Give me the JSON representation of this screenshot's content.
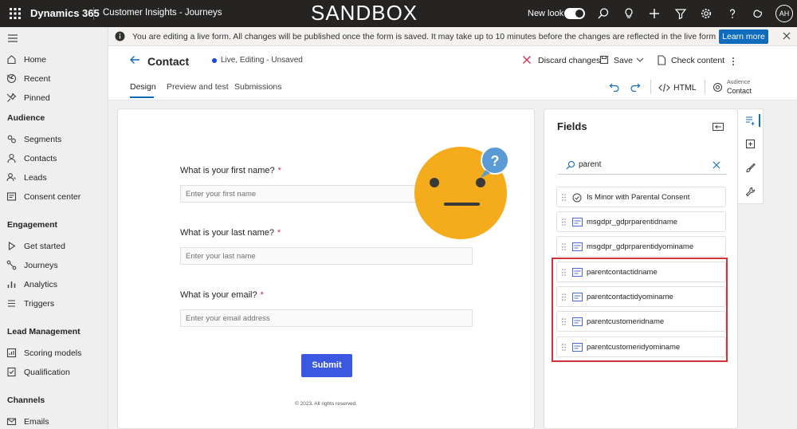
{
  "topbar": {
    "app_name": "Dynamics 365",
    "area_name": "Customer Insights - Journeys",
    "environment_label": "SANDBOX",
    "new_look_label": "New look",
    "new_look_on": true,
    "avatar_initials": "AH",
    "icons": [
      "search-icon",
      "lightbulb-icon",
      "plus-icon",
      "filter-icon",
      "gear-icon",
      "help-icon",
      "copilot-icon"
    ]
  },
  "nav": {
    "items": [
      {
        "label": "Home",
        "icon": "home-icon"
      },
      {
        "label": "Recent",
        "icon": "clock-icon",
        "expandable": true
      },
      {
        "label": "Pinned",
        "icon": "pin-icon",
        "expandable": true
      }
    ],
    "groups": [
      {
        "title": "Audience",
        "items": [
          "Segments",
          "Contacts",
          "Leads",
          "Consent center"
        ]
      },
      {
        "title": "Engagement",
        "items": [
          "Get started",
          "Journeys",
          "Analytics",
          "Triggers"
        ]
      },
      {
        "title": "Lead Management",
        "items": [
          "Scoring models",
          "Qualification"
        ]
      },
      {
        "title": "Channels",
        "items": [
          "Emails"
        ]
      }
    ]
  },
  "banner": {
    "text": "You are editing a live form. All changes will be published once the form is saved. It may take up to 10 minutes before the changes are reflected in the live form",
    "button_label": "Learn more"
  },
  "header": {
    "title": "Contact",
    "status": "Live, Editing - Unsaved",
    "discard_label": "Discard changes",
    "save_label": "Save",
    "check_label": "Check content",
    "tabs": [
      "Design",
      "Preview and test",
      "Submissions"
    ],
    "active_tab": "Design",
    "html_label": "HTML",
    "audience_label": "Audience",
    "audience_value": "Contact"
  },
  "form": {
    "questions": [
      {
        "label": "What is your first name?",
        "placeholder": "Enter your first name"
      },
      {
        "label": "What is your last name?",
        "placeholder": "Enter your last name"
      },
      {
        "label": "What is your email?",
        "placeholder": "Enter your email address"
      }
    ],
    "required_mark": "*",
    "submit_label": "Submit",
    "footer": "© 2023. All rights reserved.",
    "emoji_badge": "?"
  },
  "fields_panel": {
    "title": "Fields",
    "search_value": "parent",
    "items": [
      {
        "label": "Is Minor with Parental Consent",
        "icon": "check-circle-icon"
      },
      {
        "label": "msgdpr_gdprparentidname",
        "icon": "text-field-icon"
      },
      {
        "label": "msgdpr_gdprparentidyominame",
        "icon": "text-field-icon"
      },
      {
        "label": "parentcontactidname",
        "icon": "text-field-icon"
      },
      {
        "label": "parentcontactidyominame",
        "icon": "text-field-icon"
      },
      {
        "label": "parentcustomeridname",
        "icon": "text-field-icon"
      },
      {
        "label": "parentcustomeridyominame",
        "icon": "text-field-icon"
      }
    ]
  },
  "colors": {
    "topbar_bg": "#252423",
    "accent": "#0f6cbd",
    "submit_bg": "#3b58e0",
    "highlight": "#d13438",
    "emoji_face": "#f4ab1c",
    "emoji_badge": "#5b9bd5"
  }
}
